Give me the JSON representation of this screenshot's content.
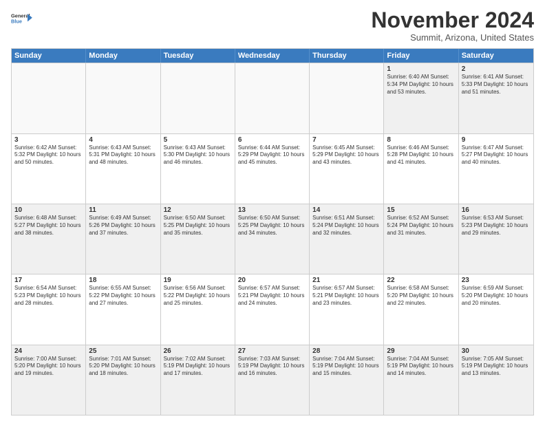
{
  "header": {
    "logo_line1": "General",
    "logo_line2": "Blue",
    "month": "November 2024",
    "location": "Summit, Arizona, United States"
  },
  "days_of_week": [
    "Sunday",
    "Monday",
    "Tuesday",
    "Wednesday",
    "Thursday",
    "Friday",
    "Saturday"
  ],
  "weeks": [
    [
      {
        "day": "",
        "data": "",
        "empty": true
      },
      {
        "day": "",
        "data": "",
        "empty": true
      },
      {
        "day": "",
        "data": "",
        "empty": true
      },
      {
        "day": "",
        "data": "",
        "empty": true
      },
      {
        "day": "",
        "data": "",
        "empty": true
      },
      {
        "day": "1",
        "data": "Sunrise: 6:40 AM\nSunset: 5:34 PM\nDaylight: 10 hours and 53 minutes.",
        "empty": false
      },
      {
        "day": "2",
        "data": "Sunrise: 6:41 AM\nSunset: 5:33 PM\nDaylight: 10 hours and 51 minutes.",
        "empty": false
      }
    ],
    [
      {
        "day": "3",
        "data": "Sunrise: 6:42 AM\nSunset: 5:32 PM\nDaylight: 10 hours and 50 minutes.",
        "empty": false
      },
      {
        "day": "4",
        "data": "Sunrise: 6:43 AM\nSunset: 5:31 PM\nDaylight: 10 hours and 48 minutes.",
        "empty": false
      },
      {
        "day": "5",
        "data": "Sunrise: 6:43 AM\nSunset: 5:30 PM\nDaylight: 10 hours and 46 minutes.",
        "empty": false
      },
      {
        "day": "6",
        "data": "Sunrise: 6:44 AM\nSunset: 5:29 PM\nDaylight: 10 hours and 45 minutes.",
        "empty": false
      },
      {
        "day": "7",
        "data": "Sunrise: 6:45 AM\nSunset: 5:29 PM\nDaylight: 10 hours and 43 minutes.",
        "empty": false
      },
      {
        "day": "8",
        "data": "Sunrise: 6:46 AM\nSunset: 5:28 PM\nDaylight: 10 hours and 41 minutes.",
        "empty": false
      },
      {
        "day": "9",
        "data": "Sunrise: 6:47 AM\nSunset: 5:27 PM\nDaylight: 10 hours and 40 minutes.",
        "empty": false
      }
    ],
    [
      {
        "day": "10",
        "data": "Sunrise: 6:48 AM\nSunset: 5:27 PM\nDaylight: 10 hours and 38 minutes.",
        "empty": false
      },
      {
        "day": "11",
        "data": "Sunrise: 6:49 AM\nSunset: 5:26 PM\nDaylight: 10 hours and 37 minutes.",
        "empty": false
      },
      {
        "day": "12",
        "data": "Sunrise: 6:50 AM\nSunset: 5:25 PM\nDaylight: 10 hours and 35 minutes.",
        "empty": false
      },
      {
        "day": "13",
        "data": "Sunrise: 6:50 AM\nSunset: 5:25 PM\nDaylight: 10 hours and 34 minutes.",
        "empty": false
      },
      {
        "day": "14",
        "data": "Sunrise: 6:51 AM\nSunset: 5:24 PM\nDaylight: 10 hours and 32 minutes.",
        "empty": false
      },
      {
        "day": "15",
        "data": "Sunrise: 6:52 AM\nSunset: 5:24 PM\nDaylight: 10 hours and 31 minutes.",
        "empty": false
      },
      {
        "day": "16",
        "data": "Sunrise: 6:53 AM\nSunset: 5:23 PM\nDaylight: 10 hours and 29 minutes.",
        "empty": false
      }
    ],
    [
      {
        "day": "17",
        "data": "Sunrise: 6:54 AM\nSunset: 5:23 PM\nDaylight: 10 hours and 28 minutes.",
        "empty": false
      },
      {
        "day": "18",
        "data": "Sunrise: 6:55 AM\nSunset: 5:22 PM\nDaylight: 10 hours and 27 minutes.",
        "empty": false
      },
      {
        "day": "19",
        "data": "Sunrise: 6:56 AM\nSunset: 5:22 PM\nDaylight: 10 hours and 25 minutes.",
        "empty": false
      },
      {
        "day": "20",
        "data": "Sunrise: 6:57 AM\nSunset: 5:21 PM\nDaylight: 10 hours and 24 minutes.",
        "empty": false
      },
      {
        "day": "21",
        "data": "Sunrise: 6:57 AM\nSunset: 5:21 PM\nDaylight: 10 hours and 23 minutes.",
        "empty": false
      },
      {
        "day": "22",
        "data": "Sunrise: 6:58 AM\nSunset: 5:20 PM\nDaylight: 10 hours and 22 minutes.",
        "empty": false
      },
      {
        "day": "23",
        "data": "Sunrise: 6:59 AM\nSunset: 5:20 PM\nDaylight: 10 hours and 20 minutes.",
        "empty": false
      }
    ],
    [
      {
        "day": "24",
        "data": "Sunrise: 7:00 AM\nSunset: 5:20 PM\nDaylight: 10 hours and 19 minutes.",
        "empty": false
      },
      {
        "day": "25",
        "data": "Sunrise: 7:01 AM\nSunset: 5:20 PM\nDaylight: 10 hours and 18 minutes.",
        "empty": false
      },
      {
        "day": "26",
        "data": "Sunrise: 7:02 AM\nSunset: 5:19 PM\nDaylight: 10 hours and 17 minutes.",
        "empty": false
      },
      {
        "day": "27",
        "data": "Sunrise: 7:03 AM\nSunset: 5:19 PM\nDaylight: 10 hours and 16 minutes.",
        "empty": false
      },
      {
        "day": "28",
        "data": "Sunrise: 7:04 AM\nSunset: 5:19 PM\nDaylight: 10 hours and 15 minutes.",
        "empty": false
      },
      {
        "day": "29",
        "data": "Sunrise: 7:04 AM\nSunset: 5:19 PM\nDaylight: 10 hours and 14 minutes.",
        "empty": false
      },
      {
        "day": "30",
        "data": "Sunrise: 7:05 AM\nSunset: 5:19 PM\nDaylight: 10 hours and 13 minutes.",
        "empty": false
      }
    ]
  ]
}
